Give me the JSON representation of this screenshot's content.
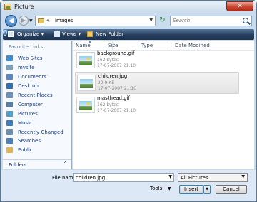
{
  "window": {
    "title": "Picture",
    "close_glyph": "✕"
  },
  "nav": {
    "back_glyph": "◀",
    "forward_glyph": "▶",
    "address_chevron": "«",
    "address_path": "images",
    "refresh_glyph": "↻",
    "search_placeholder": "Search"
  },
  "toolbar": {
    "organize": "Organize",
    "views": "Views",
    "new_folder": "New Folder",
    "help_glyph": "?"
  },
  "sidebar": {
    "title": "Favorite Links",
    "items": [
      {
        "label": "Web Sites",
        "icon": "globe-icon",
        "color": "#3a8fd4"
      },
      {
        "label": "mysite",
        "icon": "site-icon",
        "color": "#7a9fba"
      },
      {
        "label": "Documents",
        "icon": "documents-icon",
        "color": "#5b86c0"
      },
      {
        "label": "Desktop",
        "icon": "desktop-icon",
        "color": "#2f6fb5"
      },
      {
        "label": "Recent Places",
        "icon": "recent-places-icon",
        "color": "#6b8fb8"
      },
      {
        "label": "Computer",
        "icon": "computer-icon",
        "color": "#5a7da5"
      },
      {
        "label": "Pictures",
        "icon": "pictures-icon",
        "color": "#4fa0c9"
      },
      {
        "label": "Music",
        "icon": "music-icon",
        "color": "#3d7cc4"
      },
      {
        "label": "Recently Changed",
        "icon": "recently-changed-icon",
        "color": "#6f8fb0"
      },
      {
        "label": "Searches",
        "icon": "searches-icon",
        "color": "#4a7fb9"
      },
      {
        "label": "Public",
        "icon": "public-icon",
        "color": "#e2b54c"
      }
    ],
    "folders_label": "Folders",
    "folders_chevron": "⌃"
  },
  "columns": [
    "Name",
    "Size",
    "Type",
    "Date Modified"
  ],
  "files": [
    {
      "name": "background.gif",
      "size": "162 bytes",
      "date": "17-07-2007 21:10",
      "selected": false
    },
    {
      "name": "children.jpg",
      "size": "22.9 KB",
      "date": "17-07-2007 21:10",
      "selected": true
    },
    {
      "name": "masthead.gif",
      "size": "162 bytes",
      "date": "17-07-2007 21:10",
      "selected": false
    }
  ],
  "bottom": {
    "file_name_label": "File name:",
    "file_name_value": "children.jpg",
    "file_type": "All Pictures",
    "tools_label": "Tools",
    "insert_label": "Insert",
    "cancel_label": "Cancel"
  }
}
